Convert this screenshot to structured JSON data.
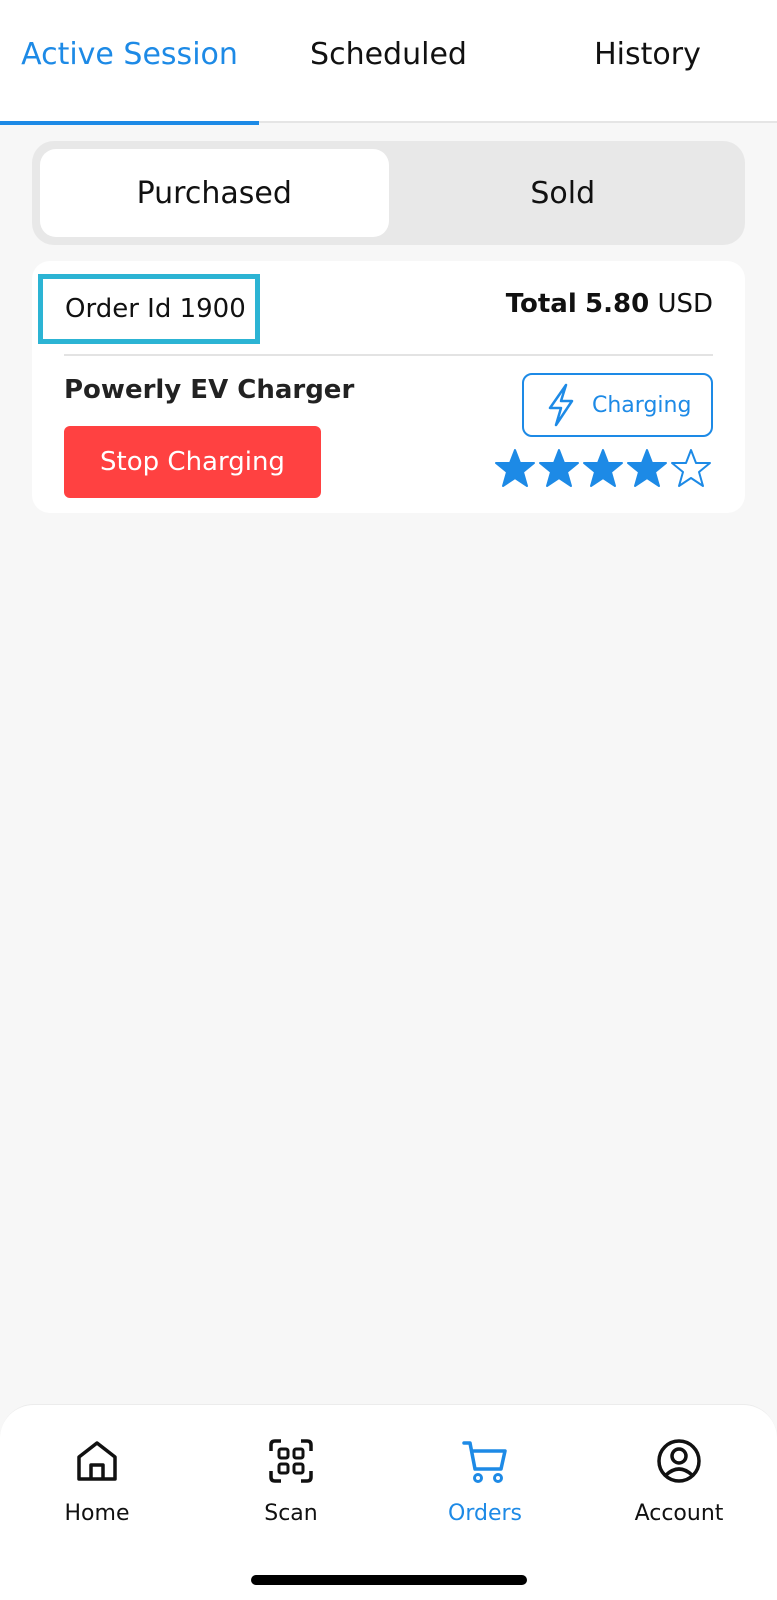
{
  "top_tabs": [
    {
      "label": "Active Session",
      "active": true
    },
    {
      "label": "Scheduled",
      "active": false
    },
    {
      "label": "History",
      "active": false
    }
  ],
  "segment": {
    "options": [
      "Purchased",
      "Sold"
    ],
    "selected": "Purchased"
  },
  "order": {
    "id_label": "Order Id 1900",
    "total_label": "Total",
    "total_amount": "5.80",
    "currency": "USD",
    "charger_name": "Powerly EV Charger",
    "stop_button": "Stop Charging",
    "status": "Charging",
    "rating": 4,
    "rating_max": 5
  },
  "bottom_nav": [
    {
      "label": "Home",
      "icon": "home-icon",
      "active": false
    },
    {
      "label": "Scan",
      "icon": "scan-icon",
      "active": false
    },
    {
      "label": "Orders",
      "icon": "cart-icon",
      "active": true
    },
    {
      "label": "Account",
      "icon": "account-icon",
      "active": false
    }
  ],
  "colors": {
    "accent": "#1d8ae6",
    "stop": "#ff4141",
    "highlight": "#2cb4d4",
    "background": "#f7f7f7"
  }
}
